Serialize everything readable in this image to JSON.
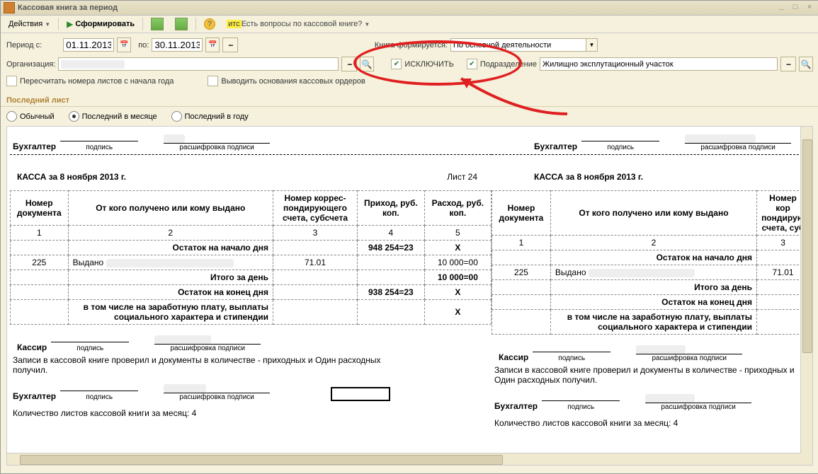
{
  "window": {
    "title": "Кассовая книга за период"
  },
  "toolbar": {
    "actions": "Действия",
    "form": "Сформировать",
    "question": "Есть вопросы по кассовой книге?",
    "its": "итс"
  },
  "filters": {
    "period_from_lbl": "Период с:",
    "period_from": "01.11.2013",
    "period_to_lbl": "по:",
    "period_to": "30.11.2013",
    "book_forms_lbl": "Книга формируется:",
    "book_forms_val": "По основной деятельности",
    "org_lbl": "Организация:",
    "org_val": "",
    "exclude": "ИСКЛЮЧИТЬ",
    "subdiv": "Подразделение",
    "subdiv_val": "Жилищно эксплутационный участок",
    "recount": "Пересчитать номера листов с начала года",
    "showbasis": "Выводить основания кассовых ордеров"
  },
  "lastsheet": {
    "title": "Последний лист",
    "o1": "Обычный",
    "o2": "Последний в месяце",
    "o3": "Последний в году"
  },
  "report": {
    "acc": "Бухгалтер",
    "sign": "подпись",
    "decr": "расшифровка подписи",
    "kassa_date": "КАССА за 8 ноября 2013 г.",
    "sheet": "Лист 24",
    "h1": "Номер документа",
    "h2": "От кого получено или кому выдано",
    "h3": "Номер коррес-пондирующего счета, субсчета",
    "h4": "Приход, руб. коп.",
    "h5": "Расход, руб. коп.",
    "n1": "1",
    "n2": "2",
    "n3": "3",
    "n4": "4",
    "n5": "5",
    "start": "Остаток на начало дня",
    "start_val": "948 254=23",
    "x": "X",
    "doc": "225",
    "who": "Выдано",
    "acc_no": "71.01",
    "out": "10 000=00",
    "day_total": "Итого за день",
    "day_out": "10 000=00",
    "end": "Остаток на конец дня",
    "end_val": "938 254=23",
    "salary": "в том числе на заработную плату, выплаты социального характера и стипендии",
    "cashier": "Кассир",
    "records": "Записи в кассовой книге проверил и документы в количестве - приходных и Один расходных получил.",
    "month": "Количество листов кассовой книги за месяц: 4"
  }
}
